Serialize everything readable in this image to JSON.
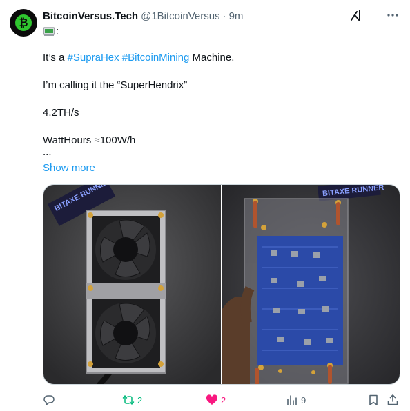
{
  "author": {
    "display_name": "BitcoinVersus.Tech",
    "handle": "@1BitcoinVersus",
    "separator": "·",
    "time": "9m",
    "avatar_glyph": "₿"
  },
  "tweet": {
    "emoji_line": ":",
    "line1_prefix": "It’s a ",
    "hashtag1": "#SupraHex",
    "hashtag2": "#BitcoinMining",
    "line1_suffix": " Machine.",
    "line2": "I’m calling it the “SuperHendrix”",
    "line3": "4.2TH/s",
    "line4": "WattHours ≈100W/h",
    "line5": "...",
    "show_more": "Show more"
  },
  "media": {
    "sticker_text_left": "BITAXE RUNNER",
    "sticker_text_right": "BITAXE RUNNER"
  },
  "actions": {
    "reply_count": "",
    "repost_count": "2",
    "like_count": "2",
    "views_count": "9"
  },
  "colors": {
    "link": "#1d9bf0",
    "repost": "#00ba7c",
    "like": "#f91880",
    "muted": "#536471"
  }
}
